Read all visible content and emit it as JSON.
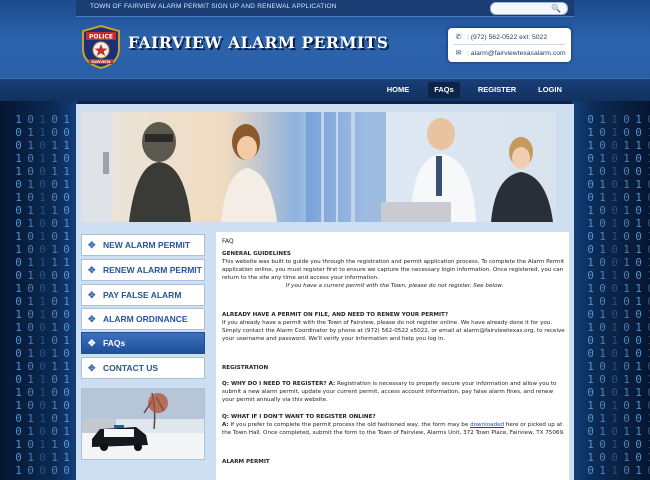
{
  "header": {
    "tagline": "TOWN OF FAIRVIEW ALARM PERMIT SIGN UP AND RENEWAL APPLICATION",
    "site_title": "FAIRVIEW ALARM PERMITS",
    "logo_text_top": "POLICE",
    "logo_text_bottom": "FAIRVIEW",
    "phone": ": (972) 562-0522 ext: 5022",
    "email": ": alarm@fairviewtexasalarm.com"
  },
  "nav": {
    "items": [
      {
        "label": "HOME"
      },
      {
        "label": "FAQs"
      },
      {
        "label": "REGISTER"
      },
      {
        "label": "LOGIN"
      }
    ],
    "active": "FAQs"
  },
  "sidebar": {
    "items": [
      {
        "label": "NEW ALARM PERMIT"
      },
      {
        "label": "RENEW ALARM PERMIT"
      },
      {
        "label": "PAY FALSE ALARM"
      },
      {
        "label": "ALARM ORDINANCE"
      },
      {
        "label": "FAQs"
      },
      {
        "label": "CONTACT US"
      }
    ],
    "active": "FAQs"
  },
  "faq": {
    "title": "FAQ",
    "general_heading": "GENERAL GUIDELINES",
    "general_text": "This website was built to guide you through the registration and permit application process. To complete the Alarm Permit application online, you must register first to ensure we capture the necessary login information. Once registered, you can return to the site any time and access your information.",
    "general_note": "If you have a current permit with the Town, please do not register. See below.",
    "permit_heading": "ALREADY HAVE A PERMIT ON FILE, AND NEED TO RENEW YOUR PERMIT?",
    "permit_text": "If you already have a permit with the Town of Fairview, please do not register online. We have already done it for you. Simply contact the Alarm Coordinator by phone at (972) 562-0522 x5022, or email at alarm@fairviewtexas.org, to receive your username and password. We'll verify your information and help you log in.",
    "registration_heading": "REGISTRATION",
    "q1": "Q: WHY DO I NEED TO REGISTER? A:",
    "a1": " Registration is necessary to properly secure your information and allow you to submit a new alarm permit, update your current permit, access account information, pay false alarm fines, and renew your permit annually via this website.",
    "q2": "Q: WHAT IF I DON'T WANT TO REGISTER ONLINE?",
    "a2_prefix": "A:",
    "a2_before": " If you prefer to complete the permit process the old fashioned way, the form may be ",
    "a2_link": "downloaded",
    "a2_after": " here or picked up at the Town Hall. Once completed, submit the form to the Town of Fairview, Alarms Unit, 372 Town Place, Fairview, TX 75069.",
    "alarm_permit_heading": "ALARM PERMIT"
  },
  "colors": {
    "header_blue": "#2c63ad",
    "nav_dark": "#12315f",
    "link_blue": "#1a46c8",
    "sidebar_active": "#1f4f99"
  },
  "icons": {
    "search": "search-icon",
    "phone": "phone-icon",
    "email": "email-icon",
    "sidebar_arrow": "move-arrows-icon"
  }
}
